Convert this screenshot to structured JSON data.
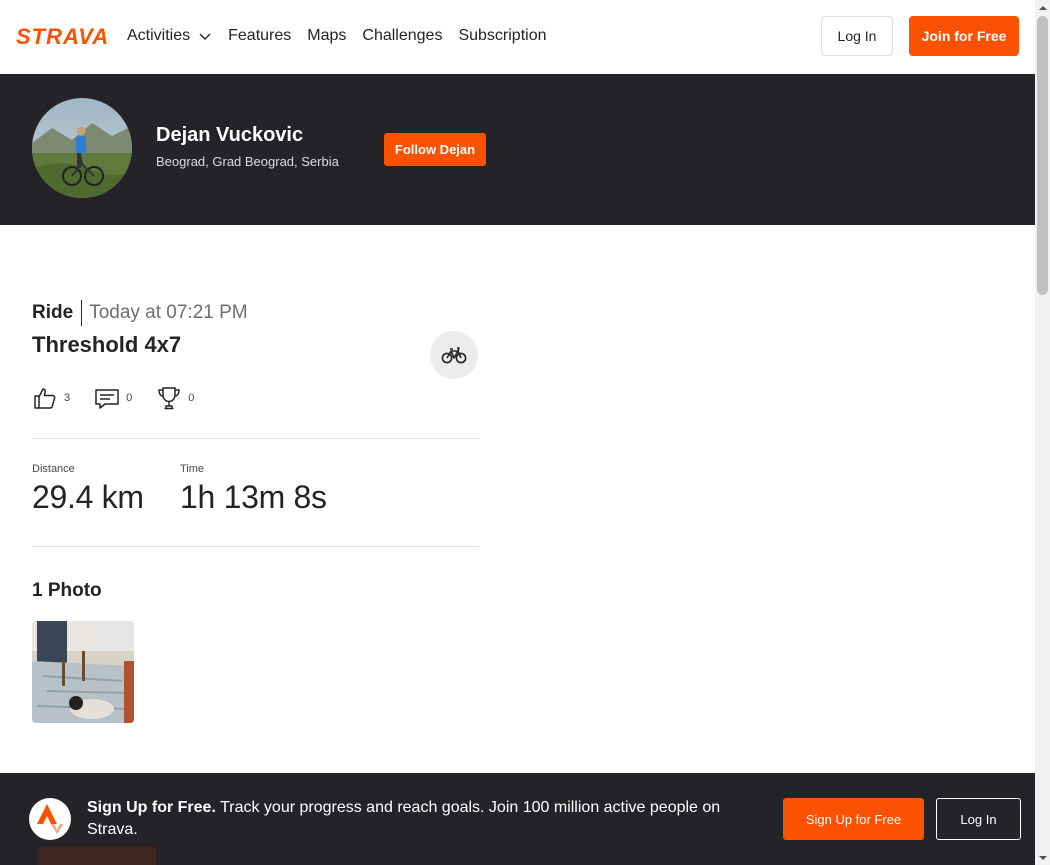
{
  "nav": {
    "logo_text": "STRAVA",
    "links": [
      {
        "label": "Activities",
        "has_dropdown": true
      },
      {
        "label": "Features"
      },
      {
        "label": "Maps"
      },
      {
        "label": "Challenges"
      },
      {
        "label": "Subscription"
      }
    ],
    "login_label": "Log In",
    "join_label": "Join for Free"
  },
  "athlete": {
    "name": "Dejan Vuckovic",
    "location": "Beograd, Grad Beograd, Serbia",
    "follow_label": "Follow Dejan"
  },
  "activity": {
    "type": "Ride",
    "time": "Today at 07:21 PM",
    "title": "Threshold 4x7",
    "sport_icon": "bike-icon",
    "kudos": "3",
    "comments": "0",
    "achievements": "0",
    "stats": [
      {
        "label": "Distance",
        "value": "29.4 km"
      },
      {
        "label": "Time",
        "value": "1h 13m 8s"
      }
    ],
    "photos_title": "1 Photo"
  },
  "banner": {
    "bold": "Sign Up for Free.",
    "text": " Track your progress and reach goals. Join 100 million active people on Strava.",
    "signup_label": "Sign Up for Free",
    "login_label": "Log In"
  },
  "colors": {
    "brand": "#fc5200",
    "dark": "#242428"
  }
}
